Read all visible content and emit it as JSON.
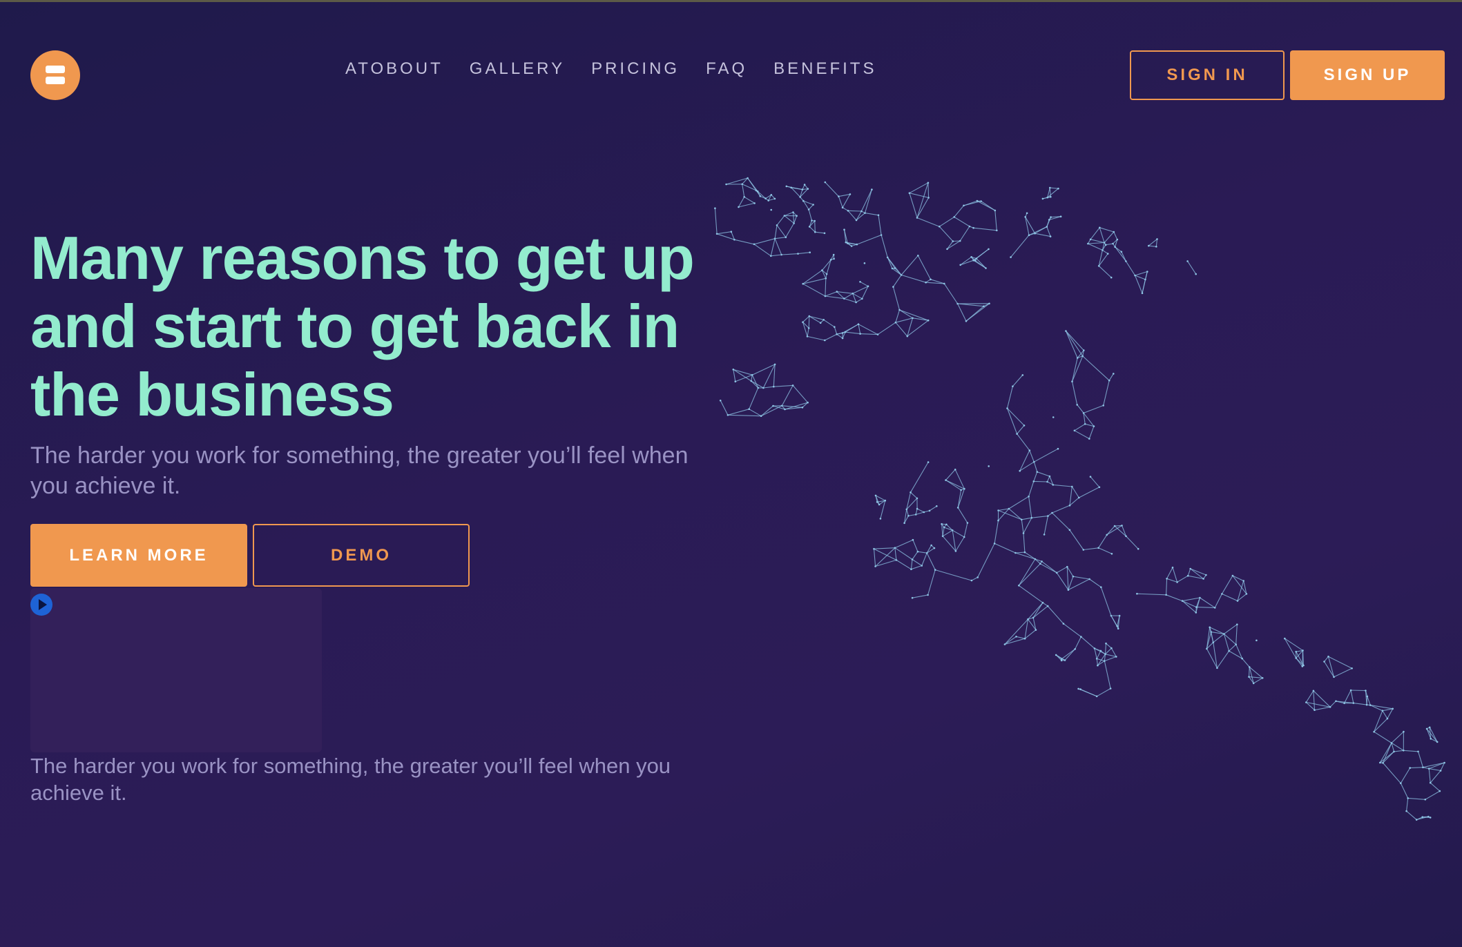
{
  "header": {
    "logo": {
      "icon": "logo-icon",
      "color": "#f0984f"
    },
    "nav": [
      {
        "label": "ATOBOUT"
      },
      {
        "label": "GALLERY"
      },
      {
        "label": "PRICING"
      },
      {
        "label": "FAQ"
      },
      {
        "label": "BENEFITS"
      }
    ],
    "sign_in_label": "SIGN IN",
    "sign_up_label": "SIGN UP"
  },
  "hero": {
    "title": "Many reasons to get up and start to get back in the business",
    "subtitle": "The harder you work for something, the greater you’ll feel when you achieve it.",
    "learn_more_label": "LEARN MORE",
    "demo_label": "DEMO"
  },
  "video": {
    "play_icon": "play-circle-icon",
    "caption": "The harder you work for something, the greater you’ll feel when you achieve it."
  },
  "illustration": {
    "icon": "wireframe-runner-icon"
  },
  "colors": {
    "accent": "#f0984f",
    "heading": "#93ecce",
    "body_text": "#9a93c4",
    "nav_text": "#c5c2dc",
    "background": "#241a50",
    "wireframe": "#8fc6e6",
    "play_button": "#1e63d6"
  }
}
